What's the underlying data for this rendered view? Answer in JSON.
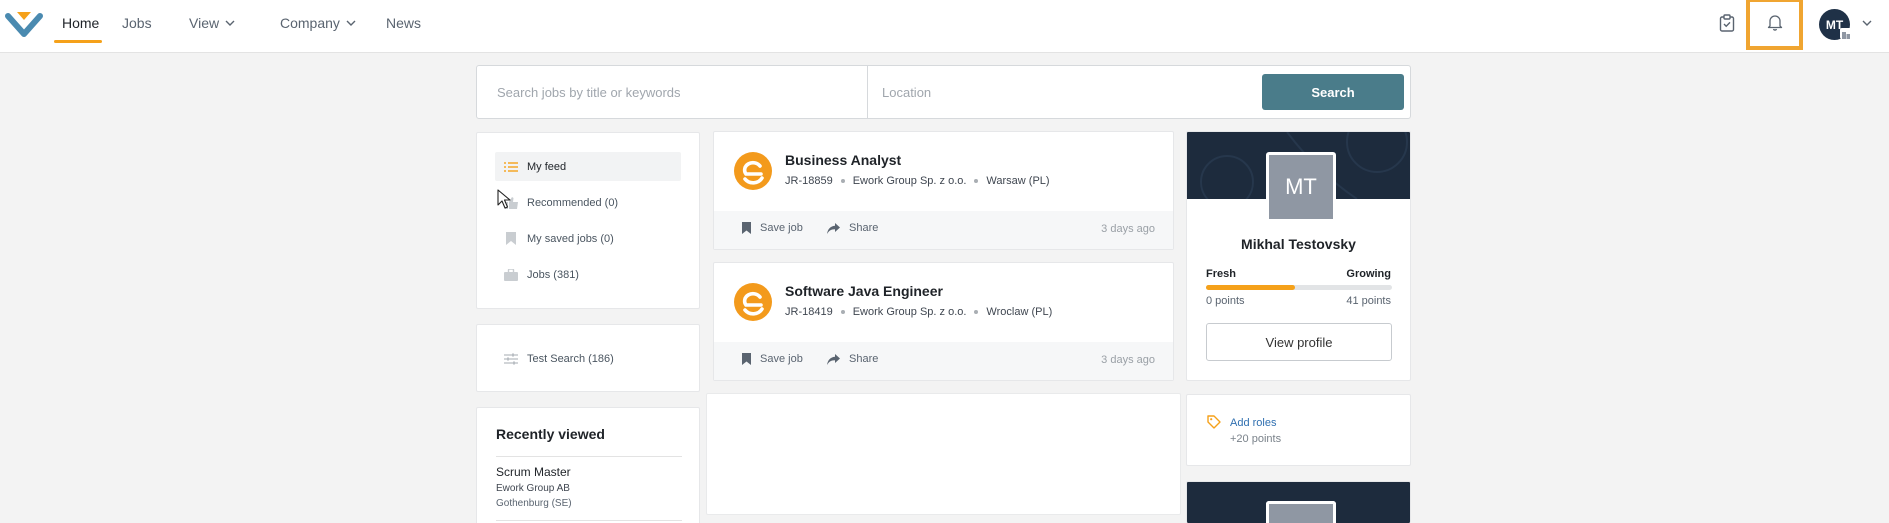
{
  "nav": {
    "home": "Home",
    "jobs": "Jobs",
    "view": "View",
    "company": "Company",
    "news": "News"
  },
  "user": {
    "initials": "MT",
    "name": "Mikhal Testovsky"
  },
  "search": {
    "keywords_placeholder": "Search jobs by title or keywords",
    "location_placeholder": "Location",
    "button": "Search"
  },
  "sidebar": {
    "items": [
      {
        "label": "My feed",
        "icon": "list-icon",
        "active": true
      },
      {
        "label": "Recommended (0)",
        "icon": "thumb-icon"
      },
      {
        "label": "My saved jobs (0)",
        "icon": "bookmark-icon"
      },
      {
        "label": "Jobs (381)",
        "icon": "briefcase-icon"
      }
    ],
    "saved_search": "Test Search (186)"
  },
  "recently_viewed": {
    "title": "Recently viewed",
    "items": [
      {
        "title": "Scrum Master",
        "company": "Ework Group AB",
        "location": "Gothenburg (SE)"
      }
    ]
  },
  "jobs": [
    {
      "title": "Business Analyst",
      "id": "JR-18859",
      "company": "Ework Group Sp. z o.o.",
      "location": "Warsaw (PL)",
      "save": "Save job",
      "share": "Share",
      "posted": "3 days ago"
    },
    {
      "title": "Software Java Engineer",
      "id": "JR-18419",
      "company": "Ework Group Sp. z o.o.",
      "location": "Wroclaw (PL)",
      "save": "Save job",
      "share": "Share",
      "posted": "3 days ago"
    }
  ],
  "profile": {
    "level_from": "Fresh",
    "level_to": "Growing",
    "points_from": "0 points",
    "points_to": "41 points",
    "progress_fraction": 0.48,
    "view_button": "View profile"
  },
  "roles": {
    "label": "Add roles",
    "points": "+20 points"
  },
  "colors": {
    "accent": "#f5a11a",
    "search_button": "#4a7c8a",
    "banner": "#1d2b3d"
  }
}
